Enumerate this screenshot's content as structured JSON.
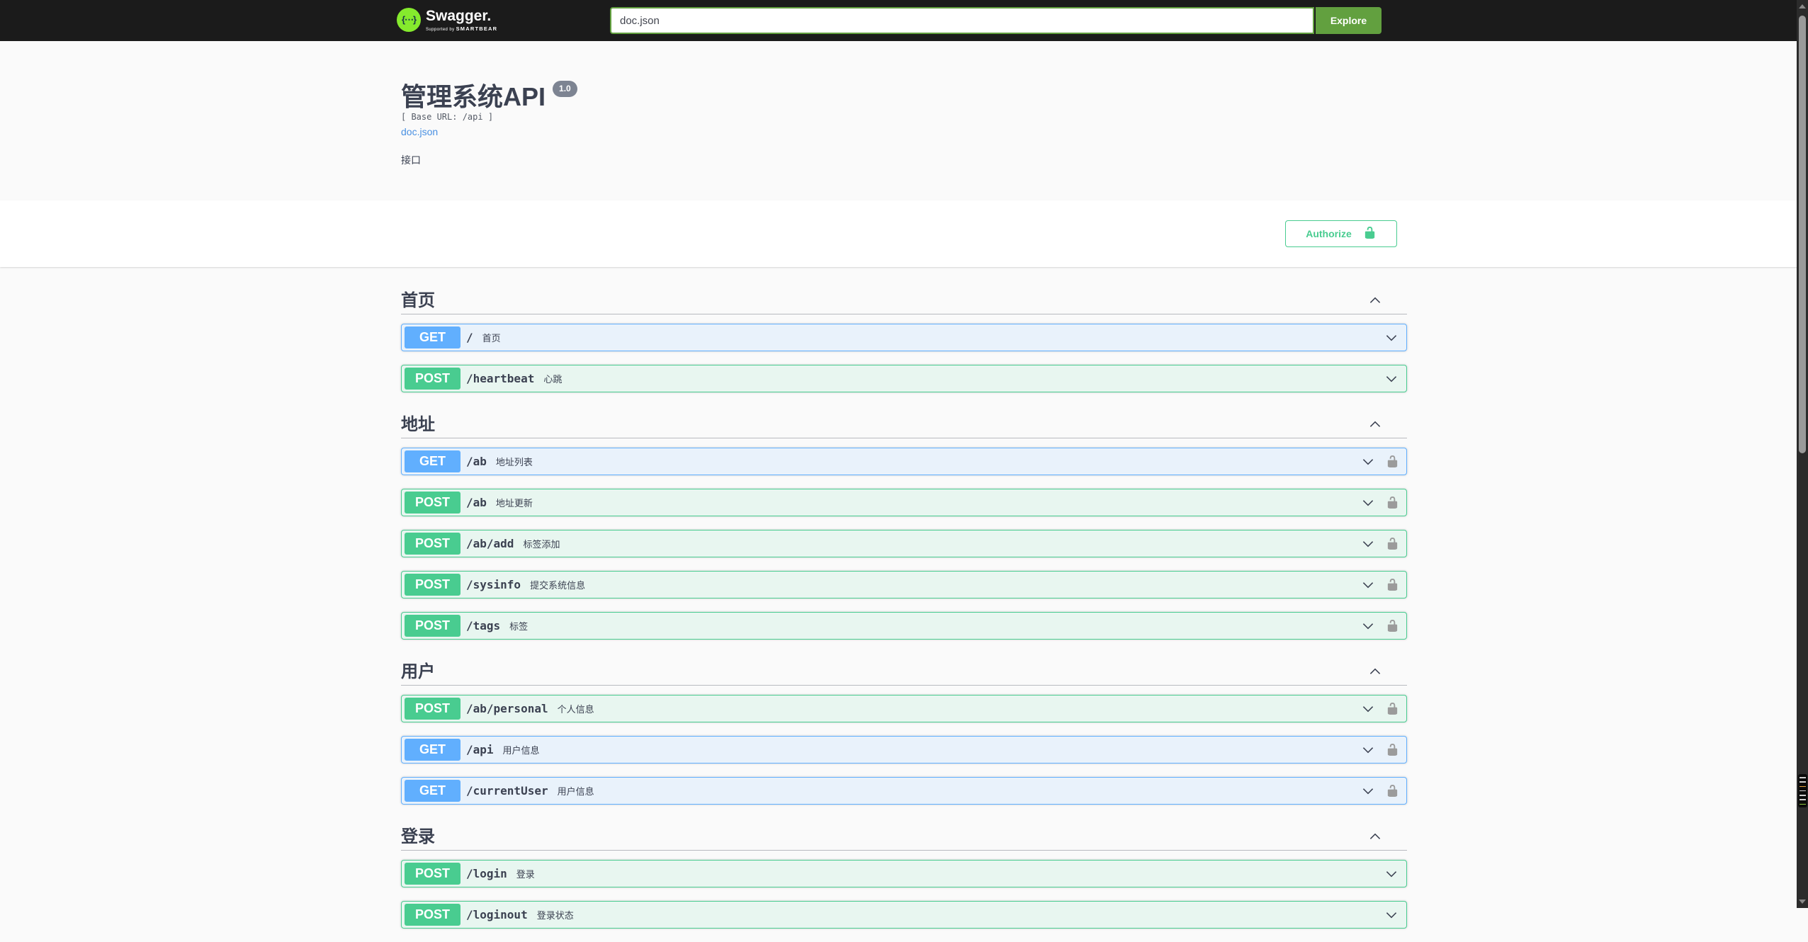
{
  "topbar": {
    "brand": "Swagger.",
    "brand_mark": "{⋯}",
    "supported_by_prefix": "Supported by",
    "supported_by_name": "SMARTBEAR",
    "search_value": "doc.json",
    "explore_label": "Explore"
  },
  "info": {
    "title": "管理系统API",
    "version_badge": "1.0",
    "base_url": "[ Base URL: /api ]",
    "doc_link": "doc.json",
    "description": "接口"
  },
  "auth": {
    "authorize_label": "Authorize"
  },
  "colors": {
    "topbar_bg": "#1b1b1b",
    "logo_green": "#85ea2d",
    "explore_green": "#62a03f",
    "get_blue": "#61affe",
    "post_green": "#49cc90",
    "auth_green": "#49cc90",
    "link_blue": "#4990e2",
    "text_dark": "#3b4151",
    "version_badge_bg": "#7d8492",
    "page_bg": "#fafafa"
  },
  "sections": [
    {
      "title": "首页",
      "expanded": true,
      "endpoints": [
        {
          "method": "GET",
          "path": "/",
          "summary": "首页",
          "lock": false
        },
        {
          "method": "POST",
          "path": "/heartbeat",
          "summary": "心跳",
          "lock": false
        }
      ]
    },
    {
      "title": "地址",
      "expanded": true,
      "endpoints": [
        {
          "method": "GET",
          "path": "/ab",
          "summary": "地址列表",
          "lock": true
        },
        {
          "method": "POST",
          "path": "/ab",
          "summary": "地址更新",
          "lock": true
        },
        {
          "method": "POST",
          "path": "/ab/add",
          "summary": "标签添加",
          "lock": true
        },
        {
          "method": "POST",
          "path": "/sysinfo",
          "summary": "提交系统信息",
          "lock": true
        },
        {
          "method": "POST",
          "path": "/tags",
          "summary": "标签",
          "lock": true
        }
      ]
    },
    {
      "title": "用户",
      "expanded": true,
      "endpoints": [
        {
          "method": "POST",
          "path": "/ab/personal",
          "summary": "个人信息",
          "lock": true
        },
        {
          "method": "GET",
          "path": "/api",
          "summary": "用户信息",
          "lock": true
        },
        {
          "method": "GET",
          "path": "/currentUser",
          "summary": "用户信息",
          "lock": true
        }
      ]
    },
    {
      "title": "登录",
      "expanded": true,
      "endpoints": [
        {
          "method": "POST",
          "path": "/login",
          "summary": "登录",
          "lock": false
        },
        {
          "method": "POST",
          "path": "/loginout",
          "summary": "登录状态",
          "lock": false
        }
      ]
    }
  ]
}
